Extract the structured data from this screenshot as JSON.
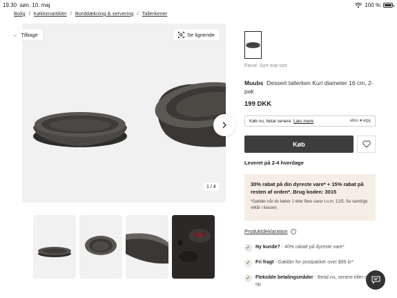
{
  "status_bar": {
    "time": "19.30",
    "date": "søn. 10. maj",
    "battery": "100 %"
  },
  "breadcrumb": [
    "Bolig",
    "Køkkenartikler",
    "Borddækning & servering",
    "Tallerkener"
  ],
  "gallery": {
    "back_label": "Tilbage",
    "similar_label": "Se lignende",
    "counter": "1 / 4"
  },
  "product": {
    "color_label": "Farve: Sort mat sort",
    "brand": "Muubs",
    "name": "Dessert tallerken Kuri diameter 16 cm, 2-pak",
    "price": "199 DKK",
    "klarna_text": "Køb nu, betal senere.",
    "klarna_link": "Læs mere",
    "klarna_logos": "ellos ♥ elpy",
    "buy_label": "Køb",
    "delivery": "Leveret på 2-4 hverdage"
  },
  "promo": {
    "headline": "30% rabat på din dyreste vare* + 15% rabat på resten af orden*. Brug koden: 3015",
    "fine_print": "*Gælder når du køber 2 eller flere varer t.o.m. 12/5. Se samtlige vilkår i kassen."
  },
  "declaration_link": "Produktdeklaration",
  "benefits": [
    {
      "title": "Ny kunde?",
      "desc": " - 40% rabatt på dyreste vare*"
    },
    {
      "title": "Fri fragt",
      "desc": " - Gælder for postpakker over $99 kr*"
    },
    {
      "title": "Fleksible betalingsmåder",
      "desc": " - Betal nu, senere eller del op"
    }
  ],
  "colors": {
    "buy_button": "#3d3d3d",
    "promo_bg": "#f6ede4",
    "image_bg": "#f1f1f1"
  }
}
